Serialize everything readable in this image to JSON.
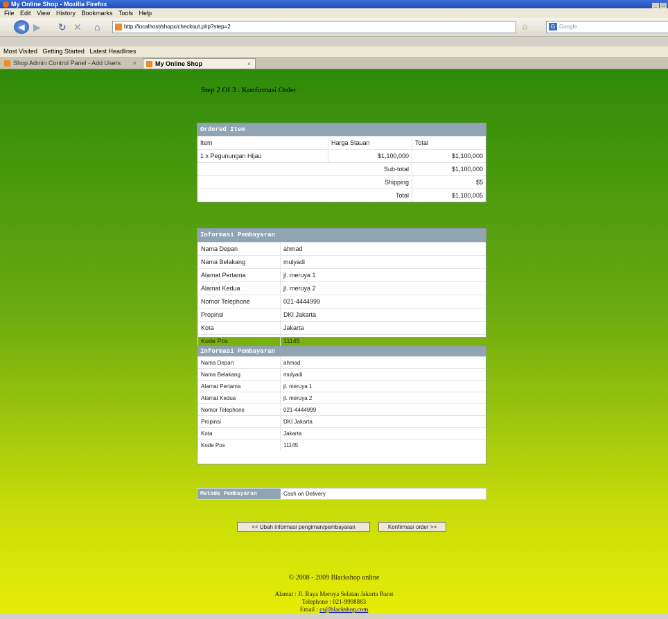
{
  "window": {
    "title": "My Online Shop - Mozilla Firefox"
  },
  "menu": [
    "File",
    "Edit",
    "View",
    "History",
    "Bookmarks",
    "Tools",
    "Help"
  ],
  "nav": {
    "url": "http://localhost/shopx/checkout.php?step=2",
    "search_placeholder": "Google"
  },
  "bookmarks": [
    "Most Visited",
    "Getting Started",
    "Latest Headlines"
  ],
  "tabs": [
    {
      "label": "Shop Admin Control Panel - Add Users"
    },
    {
      "label": "My Online Shop"
    }
  ],
  "page": {
    "step_title": "Step 2 Of 3 : Konfirmasi Order",
    "ordered": {
      "heading": "Ordered Item",
      "columns": [
        "Item",
        "Harga Stauan",
        "Total"
      ],
      "rows": [
        {
          "item": "1 x Pegunungan Hijau",
          "price": "$1,100,000",
          "total": "$1,100,000"
        }
      ],
      "subtotal": {
        "label": "Sub-total",
        "value": "$1,100,000"
      },
      "shipping": {
        "label": "Shipping",
        "value": "$5"
      },
      "grand_total": {
        "label": "Total",
        "value": "$1,100,005"
      }
    },
    "payment_info_1": {
      "heading": "Informasi Pembayaran",
      "rows": [
        {
          "label": "Nama Depan",
          "value": "ahmad"
        },
        {
          "label": "Nama Belakang",
          "value": "mulyadi"
        },
        {
          "label": "Alamat Pertama",
          "value": "jl. meruya 1"
        },
        {
          "label": "Alamat Kedua",
          "value": "jl. meruya 2"
        },
        {
          "label": "Nomor Telephone",
          "value": "021-4444999"
        },
        {
          "label": "Propinsi",
          "value": "DKI Jakarta"
        },
        {
          "label": "Kota",
          "value": "Jakarta"
        },
        {
          "label": "Kode Pos",
          "value": "11145"
        }
      ]
    },
    "payment_info_2": {
      "heading": "Informasi Pembayaran",
      "rows": [
        {
          "label": "Nama Depan",
          "value": "ahmad"
        },
        {
          "label": "Nama Belakang",
          "value": "mulyadi"
        },
        {
          "label": "Alamat Pertama",
          "value": "jl. meruya 1"
        },
        {
          "label": "Alamat Kedua",
          "value": "jl. meruya 2"
        },
        {
          "label": "Nomor Telephone",
          "value": "021-4444999"
        },
        {
          "label": "Propinsi",
          "value": "DKI Jakarta"
        },
        {
          "label": "Kota",
          "value": "Jakarta"
        },
        {
          "label": "Kode Pos",
          "value": "11145"
        }
      ]
    },
    "payment_method": {
      "label": "Metode Pembayaran",
      "value": "Cash on Delivery"
    },
    "buttons": {
      "back": "<< Ubah informasi pengiman/pembayaran",
      "confirm": "Konfirmasi order >>"
    },
    "footer": {
      "copyright": "© 2008 - 2009 Blackshop online",
      "address": "Alamat : Jl. Raya Meruya Selatan Jakarta Barat",
      "phone": "Telephone : 021-9998883",
      "email_label": "Email : ",
      "email": "cs@blackshop.com"
    }
  }
}
